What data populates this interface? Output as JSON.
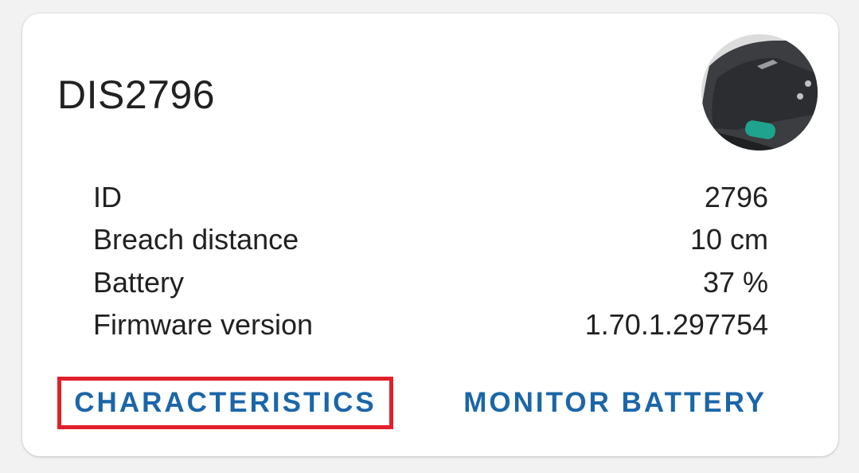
{
  "device": {
    "name": "DIS2796",
    "image_icon": "device-photo"
  },
  "details": [
    {
      "label": "ID",
      "value": "2796"
    },
    {
      "label": "Breach distance",
      "value": "10 cm"
    },
    {
      "label": "Battery",
      "value": "37 %"
    },
    {
      "label": "Firmware version",
      "value": "1.70.1.297754"
    }
  ],
  "actions": {
    "characteristics_label": "CHARACTERISTICS",
    "monitor_battery_label": "MONITOR BATTERY"
  },
  "colors": {
    "accent": "#1b66a8",
    "highlight_border": "#e2202c",
    "text": "#212121"
  }
}
